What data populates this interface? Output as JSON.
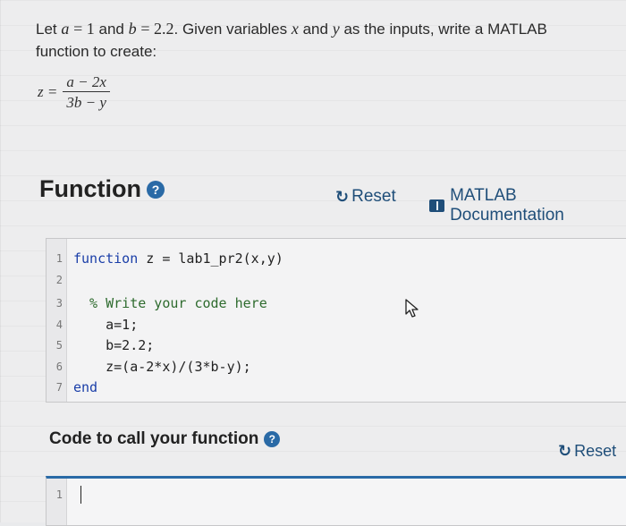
{
  "problem": {
    "let": "Let",
    "a_var": "a",
    "eq1": "= 1",
    "and1": "and",
    "b_var": "b",
    "eq2": "= 2.2",
    "rest1": ". Given variables",
    "x_var": "x",
    "and2": "and",
    "y_var": "y",
    "rest2": "as the inputs, write a MATLAB",
    "line2": "function to create:"
  },
  "formula": {
    "lhs": "z =",
    "numerator": "a − 2x",
    "denominator": "3b − y"
  },
  "function_section": {
    "title": "Function",
    "help": "?",
    "reset_label": "Reset",
    "reset_icon": "refresh-icon",
    "docs_label": "MATLAB Documentation",
    "docs_icon": "book-icon"
  },
  "editor": {
    "lines": [
      {
        "num": "1",
        "text": "function z = lab1_pr2(x,y)"
      },
      {
        "num": "2",
        "text": ""
      },
      {
        "num": "3",
        "text": "  % Write your code here"
      },
      {
        "num": "4",
        "text": "    a=1;"
      },
      {
        "num": "5",
        "text": "    b=2.2;"
      },
      {
        "num": "6",
        "text": "    z=(a-2*x)/(3*b-y);"
      },
      {
        "num": "7",
        "text": "end"
      }
    ]
  },
  "call_section": {
    "title": "Code to call your function",
    "help": "?",
    "reset_label": "Reset",
    "reset_icon": "refresh-icon"
  },
  "editor2": {
    "lines": [
      {
        "num": "1",
        "text": ""
      }
    ]
  }
}
